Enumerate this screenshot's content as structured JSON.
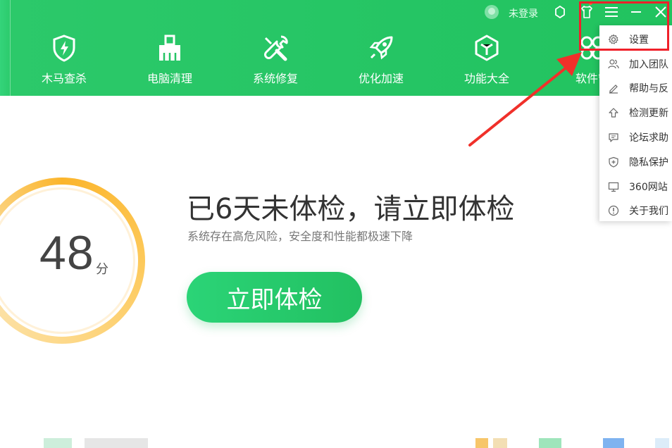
{
  "topbar": {
    "login_label": "未登录"
  },
  "nav": [
    {
      "label": "木马查杀",
      "icon": "shield-bolt-icon"
    },
    {
      "label": "电脑清理",
      "icon": "broom-icon"
    },
    {
      "label": "系统修复",
      "icon": "wrench-icon"
    },
    {
      "label": "优化加速",
      "icon": "rocket-icon"
    },
    {
      "label": "功能大全",
      "icon": "cube-icon"
    },
    {
      "label": "软件管",
      "icon": "apps-icon"
    }
  ],
  "main": {
    "score": "48",
    "score_unit": "分",
    "headline": "已6天未体检，请立即体检",
    "subline": "系统存在高危风险，安全度和性能都极速下降",
    "check_button": "立即体检"
  },
  "dropdown": {
    "items": [
      {
        "label": "设置",
        "icon": "gear-icon"
      },
      {
        "label": "加入团队",
        "icon": "team-icon"
      },
      {
        "label": "帮助与反",
        "icon": "edit-icon"
      },
      {
        "label": "检测更新",
        "icon": "upload-icon"
      },
      {
        "label": "论坛求助",
        "icon": "message-icon"
      },
      {
        "label": "隐私保护",
        "icon": "privacy-shield-icon"
      },
      {
        "label": "360网站",
        "icon": "monitor-icon"
      },
      {
        "label": "关于我们",
        "icon": "info-icon"
      }
    ]
  },
  "colors": {
    "brand_green": "#25c564",
    "ring_orange": "#fbb52c",
    "annotation_red": "#f0202a"
  }
}
